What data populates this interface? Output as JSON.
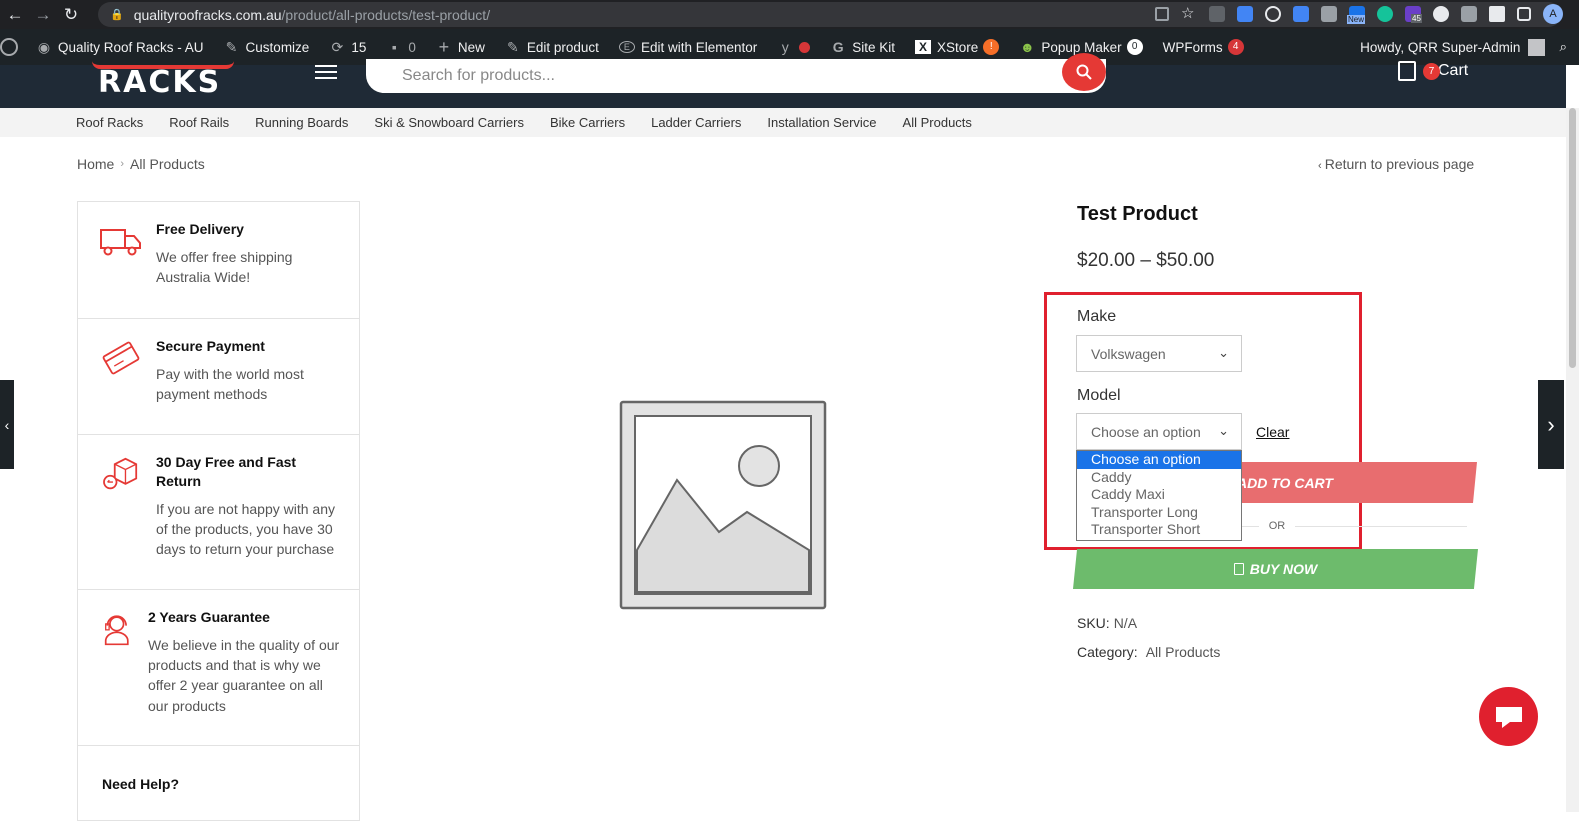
{
  "browser": {
    "url_host": "qualityroofracks.com.au",
    "url_path": "/product/all-products/test-product/",
    "ext_new_label": "New",
    "ext_count": "45",
    "profile_letter": "A"
  },
  "wp_admin": {
    "site_name": "Quality Roof Racks - AU",
    "customize": "Customize",
    "updates_count": "15",
    "comments_count": "0",
    "new_label": "New",
    "edit_product": "Edit product",
    "edit_elementor": "Edit with Elementor",
    "site_kit": "Site Kit",
    "xstore": "XStore",
    "xstore_badge": "!",
    "popup_maker": "Popup Maker",
    "popup_badge": "0",
    "wpforms": "WPForms",
    "wpforms_badge": "4",
    "howdy": "Howdy, QRR Super-Admin"
  },
  "header": {
    "logo_text": "RACKS",
    "search_placeholder": "Search for products...",
    "cart_count": "7",
    "cart_label": "Cart"
  },
  "categories": [
    "Roof Racks",
    "Roof Rails",
    "Running Boards",
    "Ski & Snowboard Carriers",
    "Bike Carriers",
    "Ladder Carriers",
    "Installation Service",
    "All Products"
  ],
  "breadcrumb": {
    "home": "Home",
    "sep": "›",
    "current": "All Products",
    "return": "Return to previous page"
  },
  "features": [
    {
      "title": "Free Delivery",
      "desc": "We offer free shipping Australia Wide!",
      "icon": "truck-icon"
    },
    {
      "title": "Secure Payment",
      "desc": "Pay with the world most payment methods",
      "icon": "credit-card-icon"
    },
    {
      "title": "30 Day Free and Fast Return",
      "desc": "If you are not happy with any of the products, you have 30 days to return your purchase",
      "icon": "return-box-icon"
    },
    {
      "title": "2 Years Guarantee",
      "desc": "We believe in the quality of our products and that is why we offer 2 year guarantee on all our products",
      "icon": "headset-icon"
    }
  ],
  "help_title": "Need Help?",
  "product": {
    "title": "Test Product",
    "price": "$20.00 – $50.00",
    "make_label": "Make",
    "make_value": "Volkswagen",
    "model_label": "Model",
    "model_value": "Choose an option",
    "clear": "Clear",
    "model_options": [
      "Choose an option",
      "Caddy",
      "Caddy Maxi",
      "Transporter Long",
      "Transporter Short"
    ],
    "add_to_cart": "ADD TO CART",
    "or": "OR",
    "buy_now": "BUY NOW",
    "sku_label": "SKU:",
    "sku_value": "N/A",
    "category_label": "Category:",
    "category_value": "All Products"
  },
  "colors": {
    "brand_red": "#e53935",
    "header_dark": "#1f2a36",
    "highlight": "#e0202e",
    "buy_green": "#6dbb6c"
  }
}
